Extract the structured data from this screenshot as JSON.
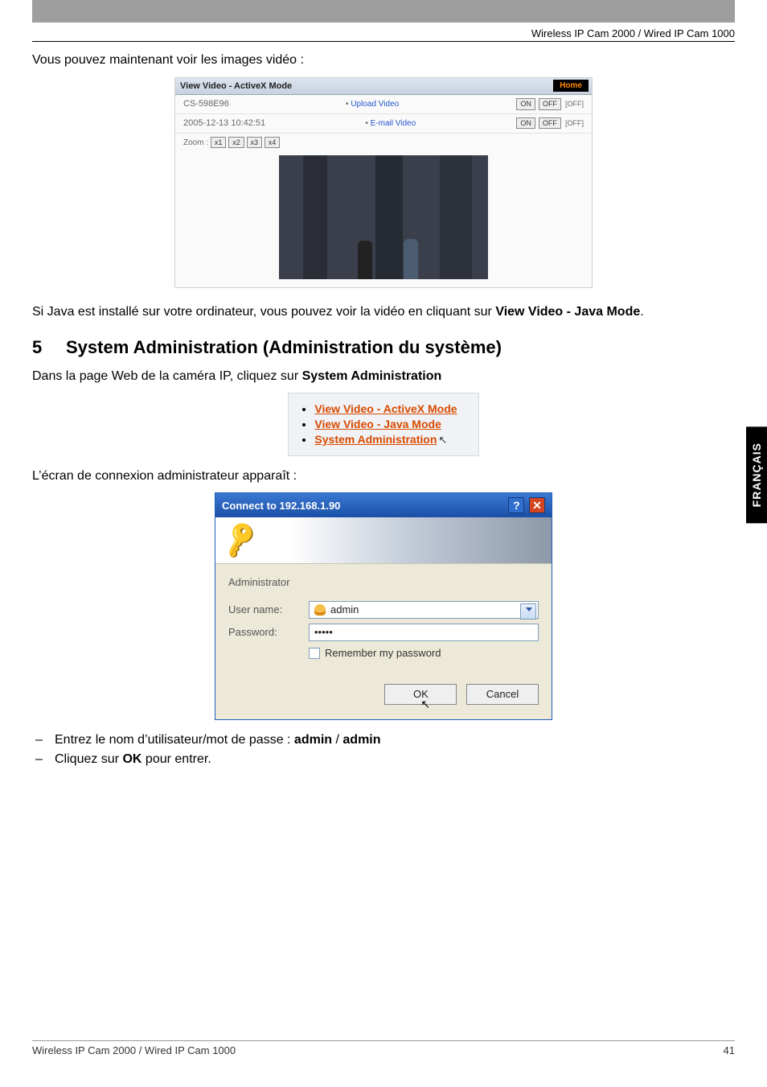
{
  "header": {
    "product": "Wireless IP Cam 2000 / Wired IP Cam 1000"
  },
  "intro": "Vous pouvez maintenant voir les images vidéo :",
  "fig1": {
    "title": "View Video - ActiveX Mode",
    "home": "Home",
    "camId": "CS-598E96",
    "timestamp": "2005-12-13 10:42:51",
    "uploadLabel": "Upload Video",
    "emailLabel": "E-mail Video",
    "on": "ON",
    "offBtn": "OFF",
    "offText": "[OFF]",
    "zoomLabel": "Zoom :",
    "zoom": [
      "x1",
      "x2",
      "x3",
      "x4"
    ]
  },
  "java_note_pre": "Si Java est installé sur votre ordinateur, vous pouvez voir la vidéo en cliquant sur ",
  "java_note_bold": "View Video - Java Mode",
  "section": {
    "num": "5",
    "title": "System Administration (Administration du système)"
  },
  "section_intro_pre": "Dans la page Web de la caméra IP, cliquez sur ",
  "section_intro_bold": "System Administration",
  "fig2": {
    "link1": "View Video - ActiveX Mode",
    "link2": "View Video - Java Mode",
    "link3": "System Administration"
  },
  "admin_screen_text": "L’écran de connexion administrateur apparaît :",
  "fig3": {
    "title": "Connect to 192.168.1.90",
    "group": "Administrator",
    "userLabel": "User name:",
    "userValue": "admin",
    "passLabel": "Password:",
    "passValue": "•••••",
    "remember": "Remember my password",
    "ok": "OK",
    "cancel": "Cancel"
  },
  "instructions": {
    "line1_pre": "Entrez le nom d’utilisateur/mot de passe : ",
    "line1_bold": "admin",
    "line1_sep": " / ",
    "line1_bold2": "admin",
    "line2_pre": "Cliquez sur ",
    "line2_bold": "OK",
    "line2_post": " pour entrer."
  },
  "sideTab": "FRANÇAIS",
  "footer": {
    "left": "Wireless IP Cam 2000 / Wired IP Cam 1000",
    "right": "41"
  }
}
